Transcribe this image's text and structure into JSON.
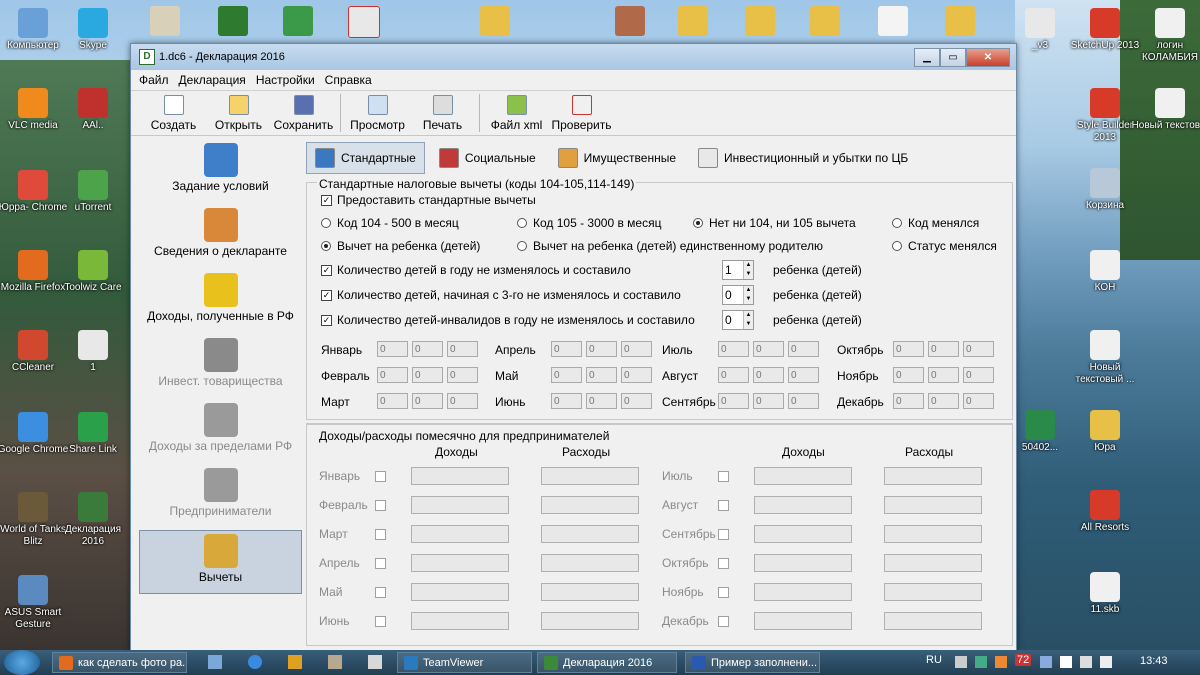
{
  "desktop": {
    "left_icons": [
      {
        "label": "Компьютер",
        "color": "#6aa0d8"
      },
      {
        "label": "Skype",
        "color": "#2aa9e0"
      },
      {
        "label": "VLC media",
        "color": "#f08a1c"
      },
      {
        "label": "AAl..",
        "color": "#c0302c"
      },
      {
        "label": "Юрра- Chrome",
        "color": "#e04a3a"
      },
      {
        "label": "uTorrent",
        "color": "#4da34a"
      },
      {
        "label": "Mozilla Firefox",
        "color": "#e36b1e"
      },
      {
        "label": "Toolwiz Care",
        "color": "#7ab83a"
      },
      {
        "label": "CCleaner",
        "color": "#d0482e"
      },
      {
        "label": "1",
        "color": "#e8e8e8"
      },
      {
        "label": "Google Chrome",
        "color": "#3c8ee0"
      },
      {
        "label": "Share Link",
        "color": "#2aa04a"
      },
      {
        "label": "World of Tanks Blitz",
        "color": "#6a5a3a"
      },
      {
        "label": "Декларация 2016",
        "color": "#3a7a3a"
      },
      {
        "label": "ASUS Smart Gesture",
        "color": "#5a8ac0"
      }
    ],
    "right_icons": [
      {
        "label": "_v3",
        "color": "#e8e8e8"
      },
      {
        "label": "SketchUp 2013",
        "color": "#d83a2a"
      },
      {
        "label": "логин КОЛАМБИЯ",
        "color": "#f0f0f0"
      },
      {
        "label": "Style Builder 2013",
        "color": "#d83a2a"
      },
      {
        "label": "Новый текстов...",
        "color": "#f0f0f0"
      },
      {
        "label": "Корзина",
        "color": "#b8c8d8"
      },
      {
        "label": "КОН",
        "color": "#f0f0f0"
      },
      {
        "label": "Новый текстовый ...",
        "color": "#f0f0f0"
      },
      {
        "label": "50402...",
        "color": "#2a8a4a"
      },
      {
        "label": "Юра",
        "color": "#e8c048"
      },
      {
        "label": "All Resorts",
        "color": "#d83a2a"
      },
      {
        "label": "11.skb",
        "color": "#f0f0f0"
      }
    ]
  },
  "window": {
    "title": "1.dc6 - Декларация 2016",
    "app_letter": "D",
    "menu": [
      "Файл",
      "Декларация",
      "Настройки",
      "Справка"
    ],
    "toolbar": [
      "Создать",
      "Открыть",
      "Сохранить",
      "Просмотр",
      "Печать",
      "Файл xml",
      "Проверить"
    ],
    "nav": [
      {
        "label": "Задание условий",
        "color": "#3f7fc9",
        "dim": false
      },
      {
        "label": "Сведения о декларанте",
        "color": "#d9883a",
        "dim": false
      },
      {
        "label": "Доходы, полученные в РФ",
        "color": "#e8c11c",
        "dim": false
      },
      {
        "label": "Инвест. товарищества",
        "color": "#8a8a8a",
        "dim": true
      },
      {
        "label": "Доходы за пределами РФ",
        "color": "#9a9a9a",
        "dim": true
      },
      {
        "label": "Предприниматели",
        "color": "#9a9a9a",
        "dim": true
      },
      {
        "label": "Вычеты",
        "color": "#d9a83a",
        "dim": false
      }
    ],
    "tabs": [
      {
        "label": "Стандартные",
        "color": "#3a78c0"
      },
      {
        "label": "Социальные",
        "color": "#c03a3a"
      },
      {
        "label": "Имущественные",
        "color": "#e0a040"
      },
      {
        "label": "Инвестиционный и убытки по ЦБ",
        "color": "#e8e8e8"
      }
    ],
    "standard": {
      "group_title": "Стандартные налоговые вычеты (коды 104-105,114-149)",
      "provide_label": "Предоставить стандартные вычеты",
      "code_options": [
        "Код 104 - 500 в месяц",
        "Код 105 - 3000 в месяц",
        "Нет ни 104, ни 105 вычета",
        "Код менялся"
      ],
      "child_options": [
        "Вычет на ребенка (детей)",
        "Вычет на ребенка (детей) единственному родителю",
        "Статус менялся"
      ],
      "child_rows": [
        {
          "label": "Количество детей в году не изменялось и составило",
          "value": "1",
          "unit": "ребенка (детей)"
        },
        {
          "label": "Количество детей, начиная с 3-го не изменялось и составило",
          "value": "0",
          "unit": "ребенка (детей)"
        },
        {
          "label": "Количество детей-инвалидов в году не изменялось и составило",
          "value": "0",
          "unit": "ребенка (детей)"
        }
      ],
      "months": [
        "Январь",
        "Февраль",
        "Март",
        "Апрель",
        "Май",
        "Июнь",
        "Июль",
        "Август",
        "Сентябрь",
        "Октябрь",
        "Ноябрь",
        "Декабрь"
      ],
      "zero": "0"
    },
    "entrepreneurs": {
      "title": "Доходы/расходы помесячно для предпринимателей",
      "income": "Доходы",
      "expense": "Расходы",
      "months": [
        "Январь",
        "Февраль",
        "Март",
        "Апрель",
        "Май",
        "Июнь",
        "Июль",
        "Август",
        "Сентябрь",
        "Октябрь",
        "Ноябрь",
        "Декабрь"
      ]
    }
  },
  "taskbar": {
    "items": [
      {
        "label": "как сделать фото ра...",
        "color": "#e36b1e"
      },
      {
        "label": "TeamViewer",
        "color": "#2a7ac0"
      },
      {
        "label": "Декларация 2016",
        "color": "#3a8a3a"
      },
      {
        "label": "Пример заполнени...",
        "color": "#2a5ab0"
      }
    ],
    "lang": "RU",
    "badge": "72",
    "clock": "13:43"
  }
}
